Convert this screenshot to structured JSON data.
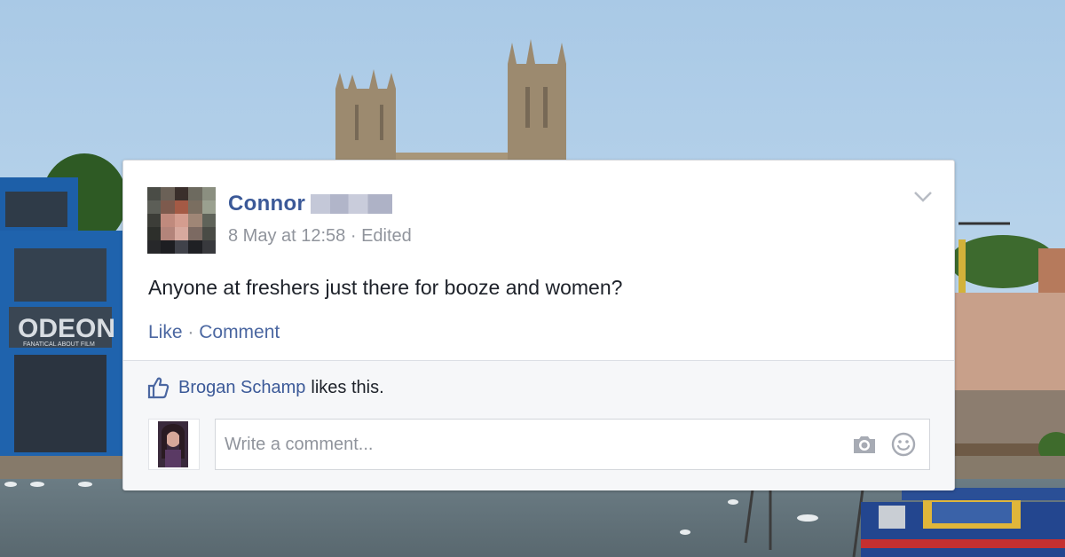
{
  "post": {
    "author": "Connor",
    "timestamp": "8 May at 12:58",
    "edited_label": "· Edited",
    "text": "Anyone at freshers just there for booze and women?",
    "actions": {
      "like": "Like",
      "separator": "·",
      "comment": "Comment"
    },
    "menu_icon": "chevron-down-icon"
  },
  "likes": {
    "icon": "thumbs-up-icon",
    "liker": "Brogan Schamp",
    "suffix": "likes this."
  },
  "comment_composer": {
    "placeholder": "Write a comment...",
    "icons": [
      "camera-icon",
      "smiley-icon"
    ]
  },
  "background": {
    "sign_main": "ODEON",
    "sign_sub": "FANATICAL ABOUT FILM"
  },
  "colors": {
    "brand_blue": "#3b5998",
    "link_blue": "#4b67a1",
    "meta_grey": "#90949c",
    "footer_bg": "#f6f7f9"
  }
}
